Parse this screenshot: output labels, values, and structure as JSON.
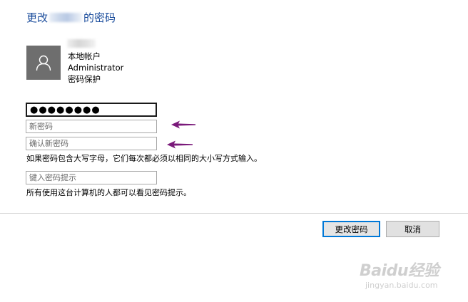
{
  "dialog": {
    "title_prefix": "更改",
    "title_suffix": "的密码"
  },
  "account": {
    "type": "本地帐户",
    "name": "Administrator",
    "protection": "密码保护"
  },
  "fields": {
    "current_password_value": "●●●●●●●●",
    "new_password_placeholder": "新密码",
    "confirm_password_placeholder": "确认新密码",
    "hint_placeholder": "键入密码提示"
  },
  "notes": {
    "case_sensitive": "如果密码包含大写字母，它们每次都必须以相同的大小写方式输入。",
    "hint_visibility": "所有使用这台计算机的人都可以看见密码提示。"
  },
  "buttons": {
    "change_password": "更改密码",
    "cancel": "取消"
  },
  "colors": {
    "title": "#1a4c9c",
    "arrow": "#7a1a7a",
    "primary_border": "#0078d7"
  },
  "watermark": {
    "brand": "Baidu经验",
    "url": "jingyan.baidu.com"
  }
}
